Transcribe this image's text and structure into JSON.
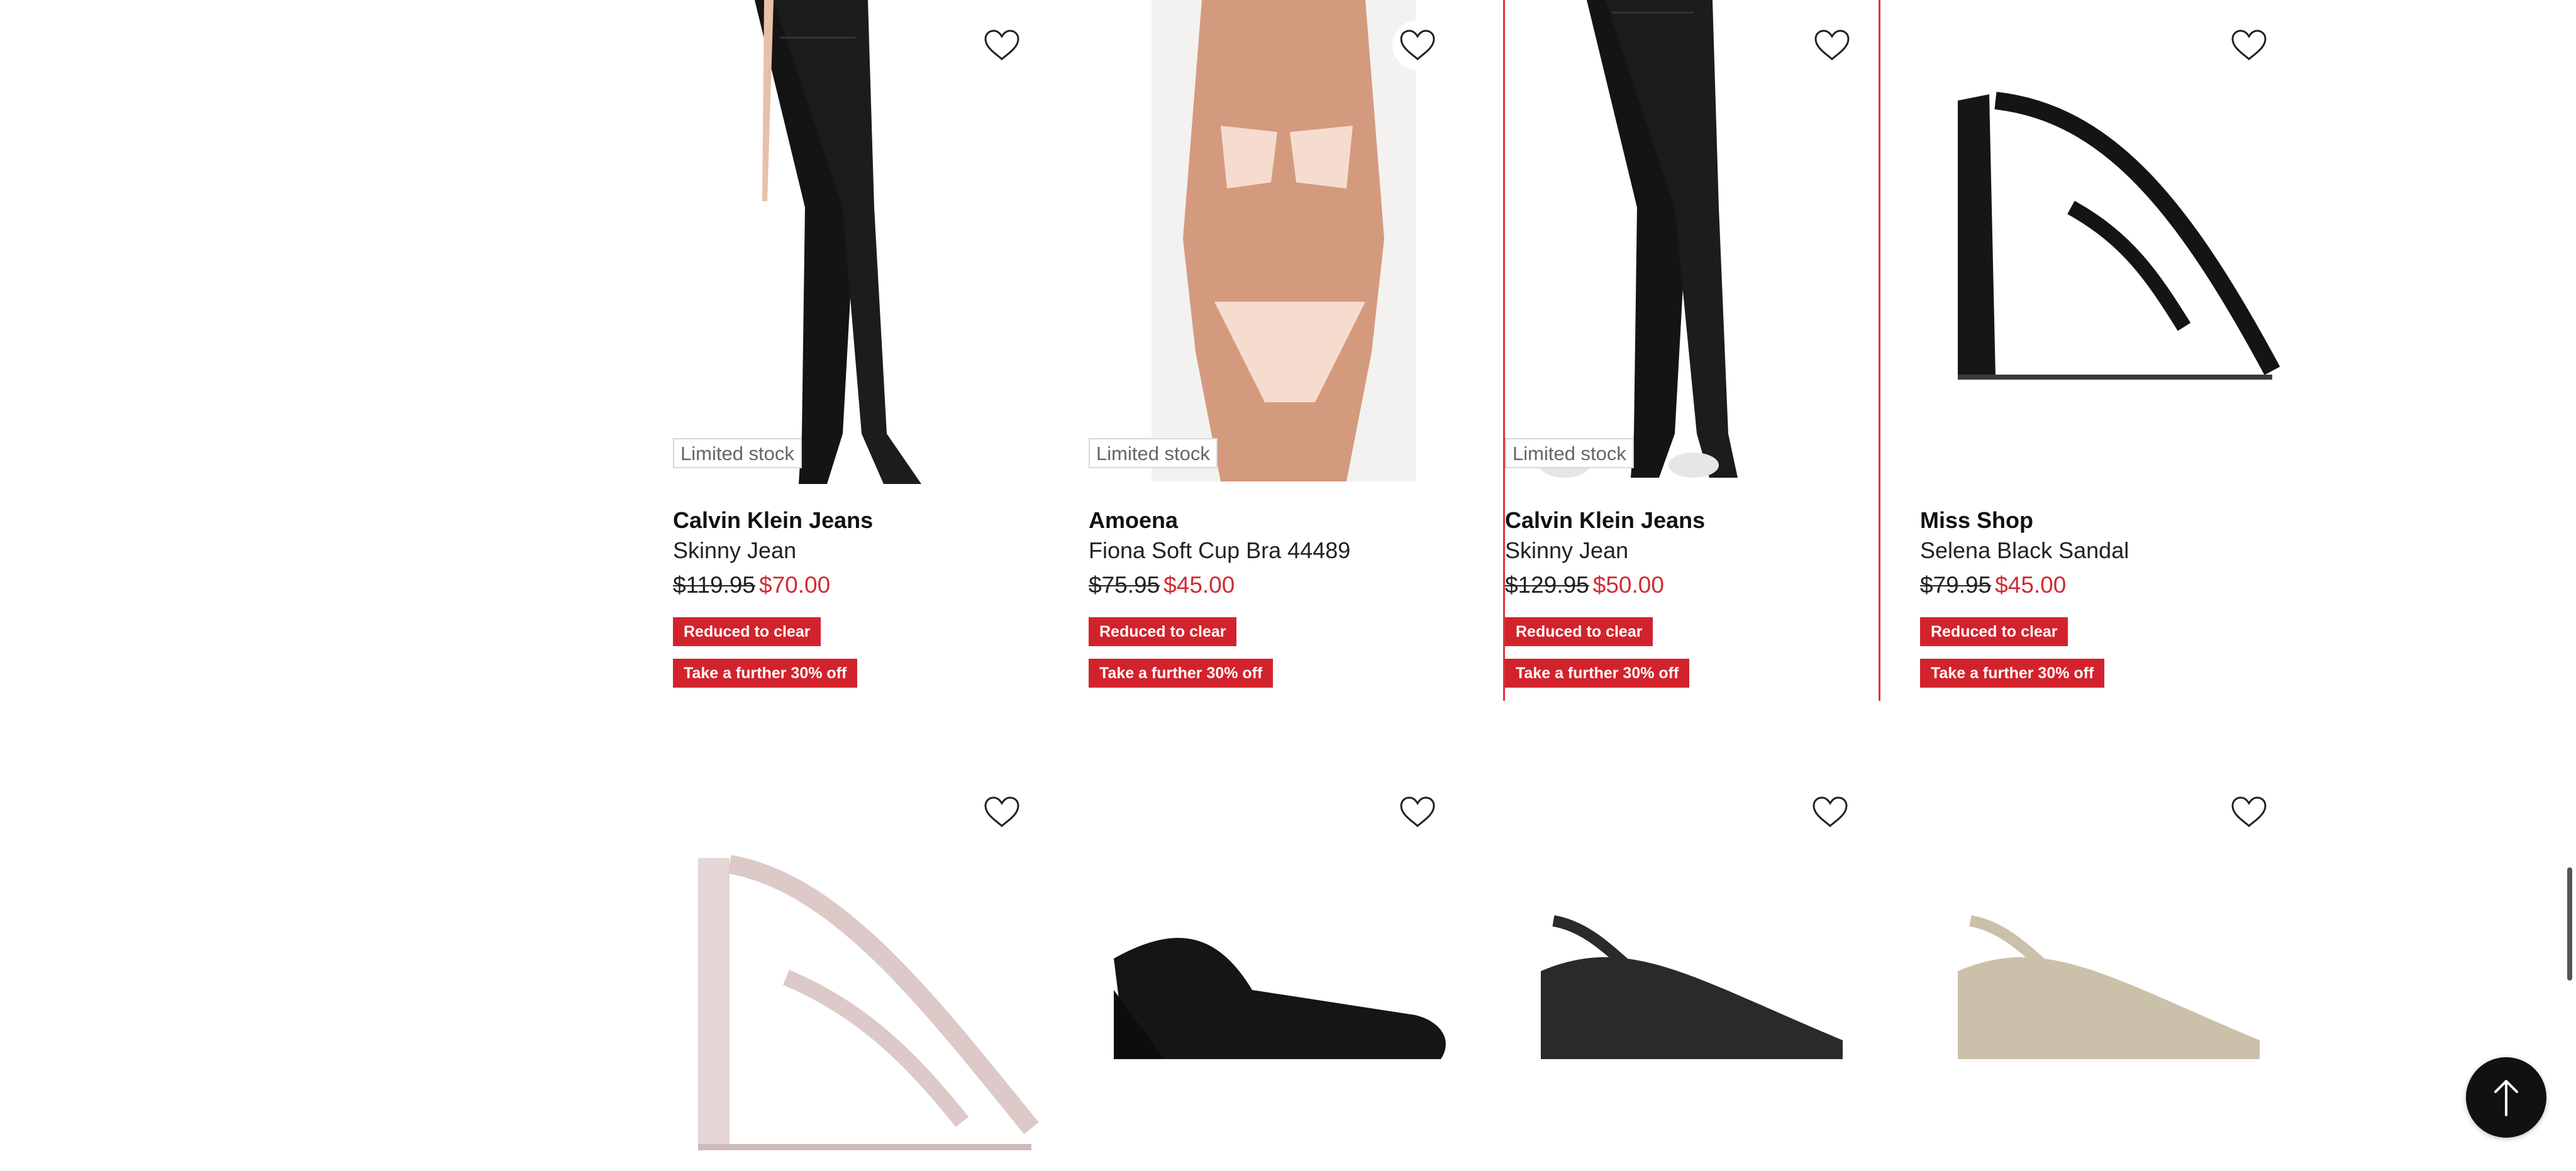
{
  "products": [
    {
      "brand": "Calvin Klein Jeans",
      "name": "Skinny Jean",
      "price_was": "$119.95",
      "price_now": "$70.00",
      "badge": "Limited stock",
      "tags": [
        "Reduced to clear",
        "Take a further 30% off"
      ],
      "image": "black-skinny-jean-model"
    },
    {
      "brand": "Amoena",
      "name": "Fiona Soft Cup Bra 44489",
      "price_was": "$75.95",
      "price_now": "$45.00",
      "badge": "Limited stock",
      "tags": [
        "Reduced to clear",
        "Take a further 30% off"
      ],
      "image": "nude-bra-model"
    },
    {
      "brand": "Calvin Klein Jeans",
      "name": "Skinny Jean",
      "price_was": "$129.95",
      "price_now": "$50.00",
      "badge": "Limited stock",
      "tags": [
        "Reduced to clear",
        "Take a further 30% off"
      ],
      "image": "black-skinny-jean-model-sneakers"
    },
    {
      "brand": "Miss Shop",
      "name": "Selena Black Sandal",
      "price_was": "$79.95",
      "price_now": "$45.00",
      "badge": "",
      "tags": [
        "Reduced to clear",
        "Take a further 30% off"
      ],
      "image": "black-block-heel-sandal"
    },
    {
      "image": "blush-block-heel-sandal"
    },
    {
      "image": "black-wedge-sandal"
    },
    {
      "image": "black-cork-wedge-slingback"
    },
    {
      "image": "beige-cork-wedge-slingback"
    }
  ],
  "colors": {
    "accent_red": "#d2232c",
    "sale_price": "#d22a33",
    "selected_outline": "#e0313b",
    "back_to_top_bg": "#111111"
  },
  "icons": {
    "wishlist": "heart-outline-icon",
    "back_to_top": "arrow-up-icon"
  }
}
